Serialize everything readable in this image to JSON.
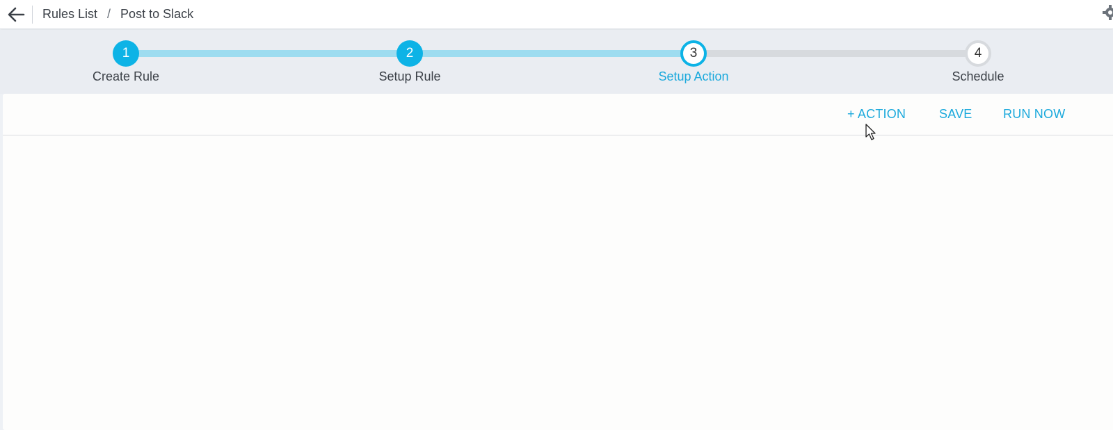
{
  "breadcrumb": {
    "parent": "Rules List",
    "separator": "/",
    "current": "Post to Slack"
  },
  "stepper": {
    "steps": [
      {
        "number": "1",
        "label": "Create Rule",
        "state": "complete"
      },
      {
        "number": "2",
        "label": "Setup Rule",
        "state": "complete"
      },
      {
        "number": "3",
        "label": "Setup Action",
        "state": "current"
      },
      {
        "number": "4",
        "label": "Schedule",
        "state": "pending"
      }
    ]
  },
  "toolbar": {
    "add_action_label": "+ ACTION",
    "save_label": "SAVE",
    "run_now_label": "RUN NOW"
  },
  "icons": {
    "back": "back-arrow-icon",
    "settings": "gear-icon",
    "cursor": "mouse-pointer-icon"
  },
  "colors": {
    "accent": "#0db3e6",
    "link": "#1ba9dc",
    "progress_done": "#9ddcf0",
    "progress_todo": "#d7dade"
  }
}
